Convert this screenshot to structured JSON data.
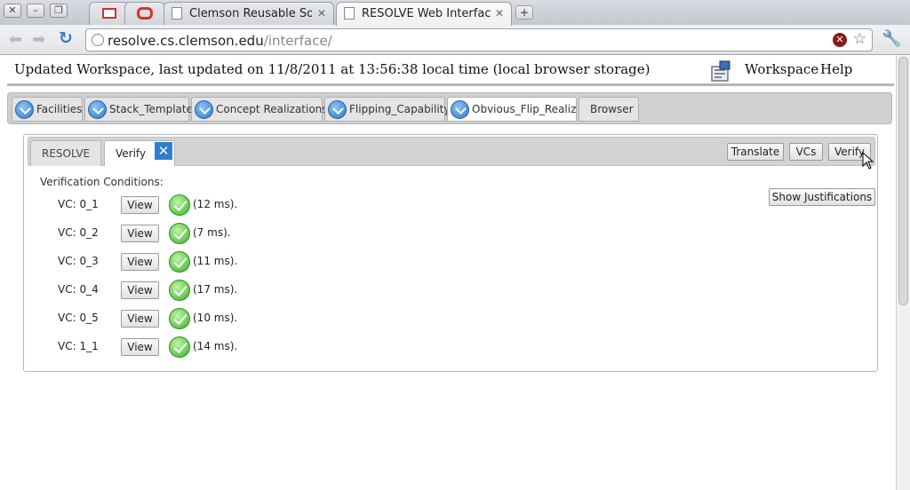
{
  "browser": {
    "tabs": [
      {
        "title": "",
        "favicon": "gmail-icon"
      },
      {
        "title": "",
        "favicon": "oracle-icon"
      },
      {
        "title": "Clemson Reusable Softw",
        "favicon": "page-icon"
      },
      {
        "title": "RESOLVE Web Interface",
        "favicon": "page-icon",
        "active": true
      }
    ],
    "url_host": "resolve.cs.clemson.edu",
    "url_path": "/interface/"
  },
  "header": {
    "title": "Updated Workspace, last updated on 11/8/2011 at 13:56:38 local time (local browser storage)",
    "workspace_link": "Workspace",
    "help_link": "Help"
  },
  "file_tabs": [
    {
      "label": "Facilities",
      "icon": "download-arrow-icon"
    },
    {
      "label": "Stack_Template",
      "icon": "download-arrow-icon"
    },
    {
      "label": "Concept Realizations",
      "icon": "download-arrow-icon"
    },
    {
      "label": "Flipping_Capability",
      "icon": "download-arrow-icon"
    },
    {
      "label": "Obvious_Flip_Realiz",
      "icon": "download-arrow-icon",
      "active": true
    },
    {
      "label": "Browser",
      "icon": ""
    }
  ],
  "panel": {
    "tabs": [
      {
        "label": "RESOLVE"
      },
      {
        "label": "Verify",
        "active": true
      }
    ],
    "actions": {
      "translate": "Translate",
      "vcs": "VCs",
      "verify": "Verify",
      "show_justifications": "Show Justifications"
    },
    "heading": "Verification Conditions:",
    "view_label": "View",
    "vcs": [
      {
        "label": "VC: 0_1",
        "time": "(12 ms).",
        "status": "proved"
      },
      {
        "label": "VC: 0_2",
        "time": "(7 ms).",
        "status": "proved"
      },
      {
        "label": "VC: 0_3",
        "time": "(11 ms).",
        "status": "proved"
      },
      {
        "label": "VC: 0_4",
        "time": "(17 ms).",
        "status": "proved"
      },
      {
        "label": "VC: 0_5",
        "time": "(10 ms).",
        "status": "proved"
      },
      {
        "label": "VC: 1_1",
        "time": "(14 ms).",
        "status": "proved"
      }
    ]
  },
  "colors": {
    "accent_blue": "#2b7fd0",
    "success_green": "#3bb22a"
  }
}
